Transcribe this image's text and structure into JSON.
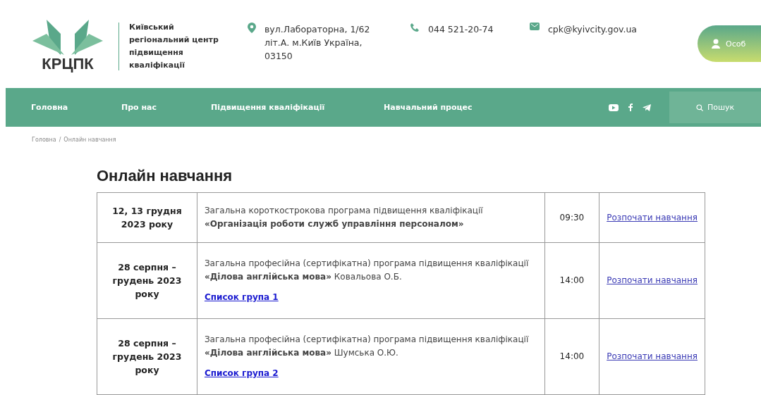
{
  "header": {
    "logo_text": "КРЦПК",
    "org_name": "Київський регіональний центр підвищення кваліфікації",
    "address": "вул.Лабораторна, 1/62 літ.А. м.Київ Україна, 03150",
    "phone": "044 521-20-74",
    "email": "cpk@kyivcity.gov.ua",
    "account_button": "Особ"
  },
  "nav": {
    "items": [
      "Головна",
      "Про нас",
      "Підвищення кваліфікації",
      "Навчальний процес"
    ],
    "search": "Пошук"
  },
  "breadcrumb": [
    "Головна",
    "Онлайн навчання"
  ],
  "breadcrumb_separator": "/",
  "page_title": "Онлайн навчання",
  "table": {
    "rows": [
      {
        "date": "12, 13 грудня 2023 року",
        "program": "Загальна  короткострокова програма підвищення кваліфікації",
        "title": "**«Організація роботи служб управління персоналом»**",
        "time": "09:30",
        "action": "Розпочати навчання"
      },
      {
        "date": "28 серпня – грудень 2023 року",
        "program": "Загальна професійна (сертифікатна) програма підвищення кваліфікації",
        "title": "**«Ділова англійська мова»** Ковальова О.Б.",
        "group_link": "Список група 1",
        "time": "14:00",
        "action": "Розпочати навчання"
      },
      {
        "date": "28 серпня – грудень 2023 року",
        "program": "Загальна професійна (сертифікатна) програма підвищення кваліфікації",
        "title": "**«Ділова англійська мова»** Шумська О.Ю.",
        "group_link": "Список група 2",
        "time": "14:00",
        "action": "Розпочати навчання"
      }
    ]
  }
}
